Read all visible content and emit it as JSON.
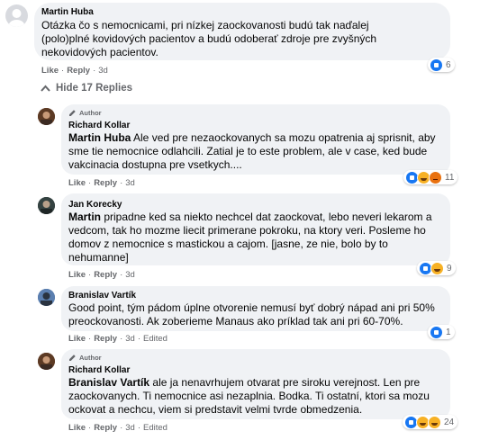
{
  "comments": [
    {
      "name": "Martin Huba",
      "text": "Otázka čo s nemocnicami, pri nízkej zaockovanosti budú tak naďalej (polo)plné kovidových pacientov a budú odoberať zdroje pre zvyšných nekovidových pacientov.",
      "like": "Like",
      "reply": "Reply",
      "time": "3d",
      "reactions": {
        "count": "6",
        "types": [
          "like"
        ]
      }
    }
  ],
  "hide_replies": "Hide 17 Replies",
  "replies": [
    {
      "badge": "Author",
      "name": "Richard Kollar",
      "mention": "Martin Huba",
      "text": " Ale ved pre nezaockovanych sa mozu opatrenia aj sprisnit, aby sme tie nemocnice odlahcili. Zatial je to este problem, ale v case, ked bude vakcinacia dostupna pre vsetkych....",
      "like": "Like",
      "reply": "Reply",
      "time": "3d",
      "edited": "",
      "reactions": {
        "count": "11",
        "types": [
          "like",
          "haha",
          "angry"
        ]
      }
    },
    {
      "badge": "",
      "name": "Jan Korecky",
      "mention": "Martin",
      "text": " pripadne ked sa niekto nechcel dat zaockovat, lebo neveri lekarom a vedcom, tak ho mozme liecit primerane pokroku, na ktory veri. Posleme ho domov z nemocnice s mastickou a cajom. [jasne, ze nie, bolo by to nehumanne]",
      "like": "Like",
      "reply": "Reply",
      "time": "3d",
      "edited": "",
      "reactions": {
        "count": "9",
        "types": [
          "like",
          "haha"
        ]
      }
    },
    {
      "badge": "",
      "name": "Branislav Vartík",
      "mention": "",
      "text": "Good point, tým pádom úplne otvorenie nemusí byť dobrý nápad ani pri 50% preockovanosti. Ak zoberieme Manaus ako príklad tak ani pri 60-70%.",
      "like": "Like",
      "reply": "Reply",
      "time": "3d",
      "edited": "Edited",
      "reactions": {
        "count": "1",
        "types": [
          "like"
        ]
      }
    },
    {
      "badge": "Author",
      "name": "Richard Kollar",
      "mention": "Branislav Vartík",
      "text": " ale ja nenavrhujem otvarat pre siroku verejnost. Len pre zaockovanych. Ti nemocnice asi nezaplnia. Bodka. Ti ostatní, ktori sa mozu ockovat a nechcu, viem si predstavit velmi tvrde obmedzenia.",
      "like": "Like",
      "reply": "Reply",
      "time": "3d",
      "edited": "Edited",
      "reactions": {
        "count": "24",
        "types": [
          "like",
          "haha",
          "haha"
        ]
      }
    }
  ],
  "colors": {
    "bubble": "#f0f2f5",
    "meta": "#65676b",
    "like_blue": "#1877f2"
  },
  "icons": [
    "pencil-icon",
    "chevron-up-icon",
    "like-reaction-icon",
    "haha-reaction-icon",
    "angry-reaction-icon"
  ]
}
